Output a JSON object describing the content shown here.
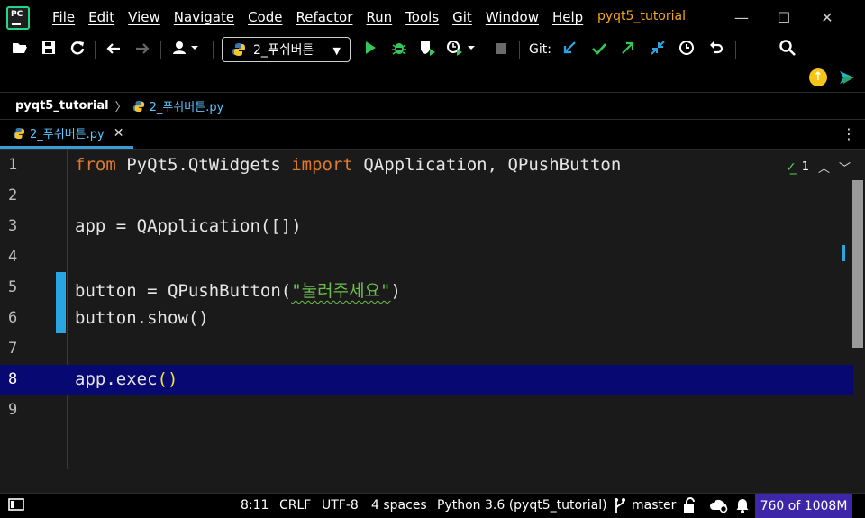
{
  "window": {
    "project_title": "pyqt5_tutorial",
    "minimize_label": "—",
    "maximize_label": "☐",
    "close_label": "✕"
  },
  "menu": {
    "items": [
      "File",
      "Edit",
      "View",
      "Navigate",
      "Code",
      "Refactor",
      "Run",
      "Tools",
      "Git",
      "Window",
      "Help"
    ]
  },
  "toolbar": {
    "run_config": "2_푸쉬버튼",
    "git_label": "Git:",
    "icons": [
      "open-folder-icon",
      "save-icon",
      "sync-icon",
      "back-arrow-icon",
      "forward-arrow-icon",
      "user-icon",
      "run-icon",
      "debug-icon",
      "coverage-icon",
      "profile-icon",
      "stop-icon",
      "git-update-icon",
      "git-commit-icon",
      "git-push-icon",
      "git-compare-icon",
      "history-icon",
      "rollback-icon",
      "search-icon",
      "update-icon",
      "ai-assistant-icon"
    ]
  },
  "breadcrumb": {
    "project": "pyqt5_tutorial",
    "file": "2_푸쉬버튼.py"
  },
  "tab": {
    "label": "2_푸쉬버튼.py"
  },
  "editor": {
    "inspection_count": "1",
    "lines": [
      {
        "num": "1"
      },
      {
        "num": "2"
      },
      {
        "num": "3"
      },
      {
        "num": "4"
      },
      {
        "num": "5"
      },
      {
        "num": "6"
      },
      {
        "num": "7"
      },
      {
        "num": "8"
      },
      {
        "num": "9"
      }
    ],
    "code": {
      "l1_kw1": "from",
      "l1_mid": " PyQt5.QtWidgets ",
      "l1_kw2": "import",
      "l1_rest": " QApplication, QPushButton",
      "l3": "app = QApplication([])",
      "l5_pre": "button = QPushButton(",
      "l5_str": "\"눌러주세요\"",
      "l5_post": ")",
      "l6": "button.show()",
      "l8_pre": "app.exec",
      "l8_paren": "()"
    }
  },
  "status": {
    "position": "8:11",
    "line_ending": "CRLF",
    "encoding": "UTF-8",
    "indent": "4 spaces",
    "interpreter": "Python 3.6 (pyqt5_tutorial)",
    "branch": "master",
    "memory": "760 of 1008M"
  },
  "colors": {
    "keyword": "#e07a2a",
    "string": "#6cbf4a",
    "current_line": "#080873",
    "accent": "#2aa5e0",
    "memory_bg": "#3d27a8"
  }
}
